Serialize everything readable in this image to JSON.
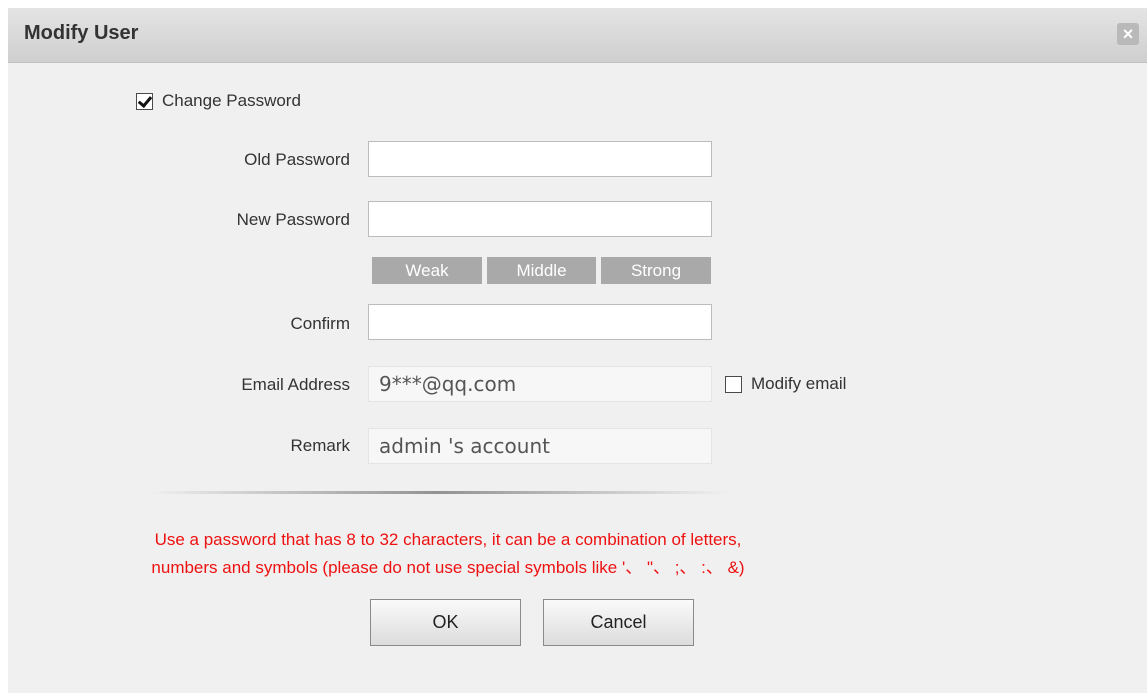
{
  "dialog": {
    "title": "Modify User"
  },
  "form": {
    "change_password_label": "Change Password",
    "change_password_checked": true,
    "old_password_label": "Old Password",
    "old_password_value": "",
    "new_password_label": "New Password",
    "new_password_value": "",
    "strength": {
      "weak": "Weak",
      "middle": "Middle",
      "strong": "Strong"
    },
    "confirm_label": "Confirm",
    "confirm_value": "",
    "email_label": "Email Address",
    "email_value": "9***@qq.com",
    "modify_email_label": "Modify email",
    "modify_email_checked": false,
    "remark_label": "Remark",
    "remark_value": "admin 's account"
  },
  "notice": {
    "line1": "Use a password that has 8 to 32 characters, it can be a combination of letters,",
    "line2": "numbers and symbols (please do not use special symbols like '、 \"、 ;、 :、 &)"
  },
  "buttons": {
    "ok_label": "OK",
    "cancel_label": "Cancel"
  },
  "colors": {
    "notice_text": "#ee1111",
    "strength_bar": "#a9a9a9",
    "dialog_bg": "#f0f0f0"
  }
}
